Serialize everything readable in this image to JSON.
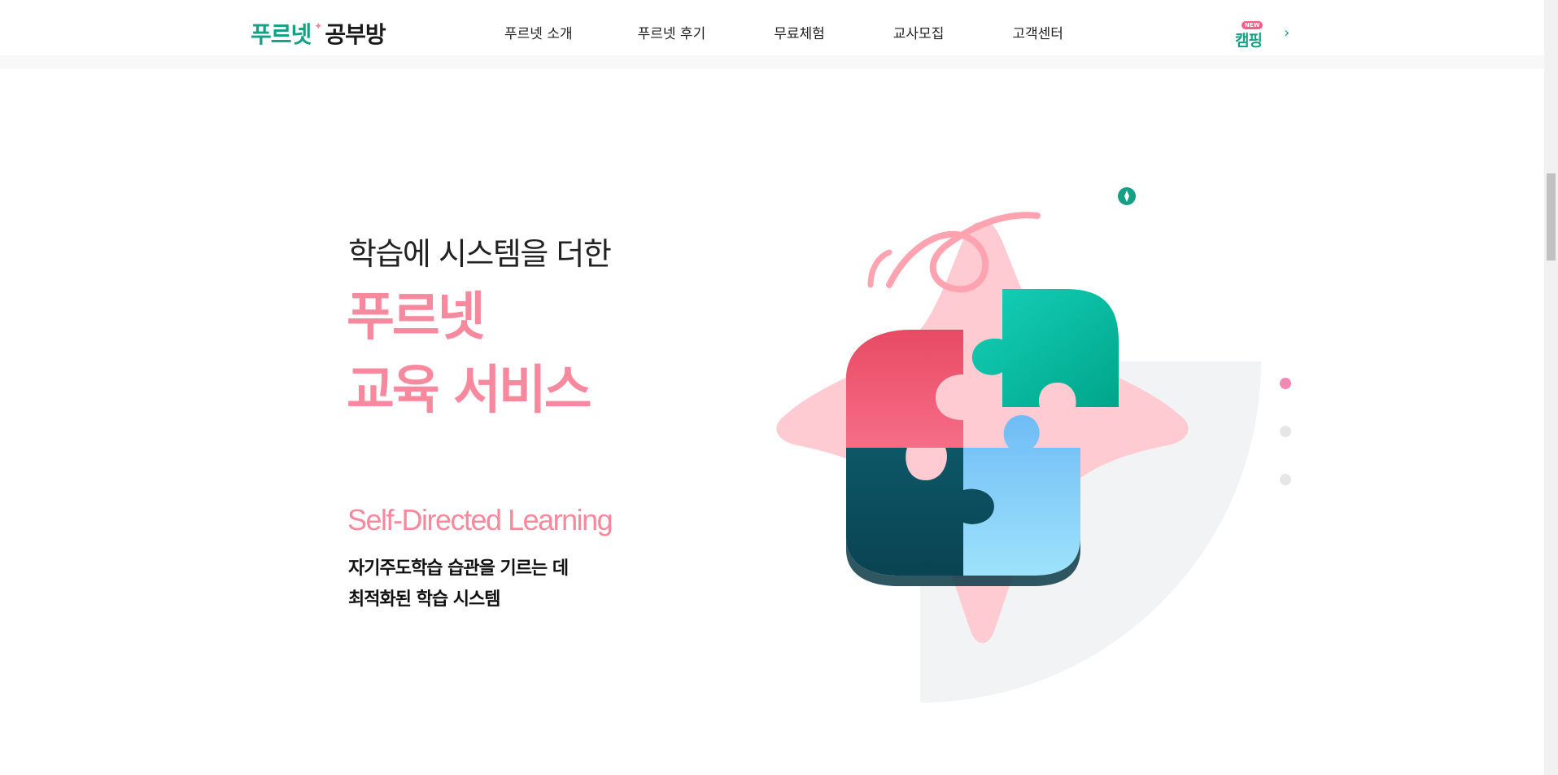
{
  "header": {
    "logo_brand": "푸르넷",
    "logo_star": "✦",
    "logo_sub": "공부방",
    "nav": [
      {
        "label": "푸르넷 소개"
      },
      {
        "label": "푸르넷 후기"
      },
      {
        "label": "무료체험"
      },
      {
        "label": "교사모집"
      },
      {
        "label": "고객센터"
      }
    ],
    "camp_badge_top": "NEW",
    "camp_badge_main": "캠핑",
    "chevron": "›"
  },
  "hero": {
    "pre_title": "학습에 시스템을 더한",
    "title_line1": "푸르넷",
    "title_line2": "교육 서비스",
    "sub_en": "Self-Directed Learning",
    "desc_line1": "자기주도학습 습관을 기르는 데",
    "desc_line2": "최적화된 학습 시스템"
  },
  "slider": {
    "active_index": 0,
    "count": 3
  },
  "colors": {
    "brand_green": "#14a085",
    "accent_pink": "#f7899e",
    "dot_active": "#f08ab4",
    "dot_inactive": "#e6e6e6"
  }
}
